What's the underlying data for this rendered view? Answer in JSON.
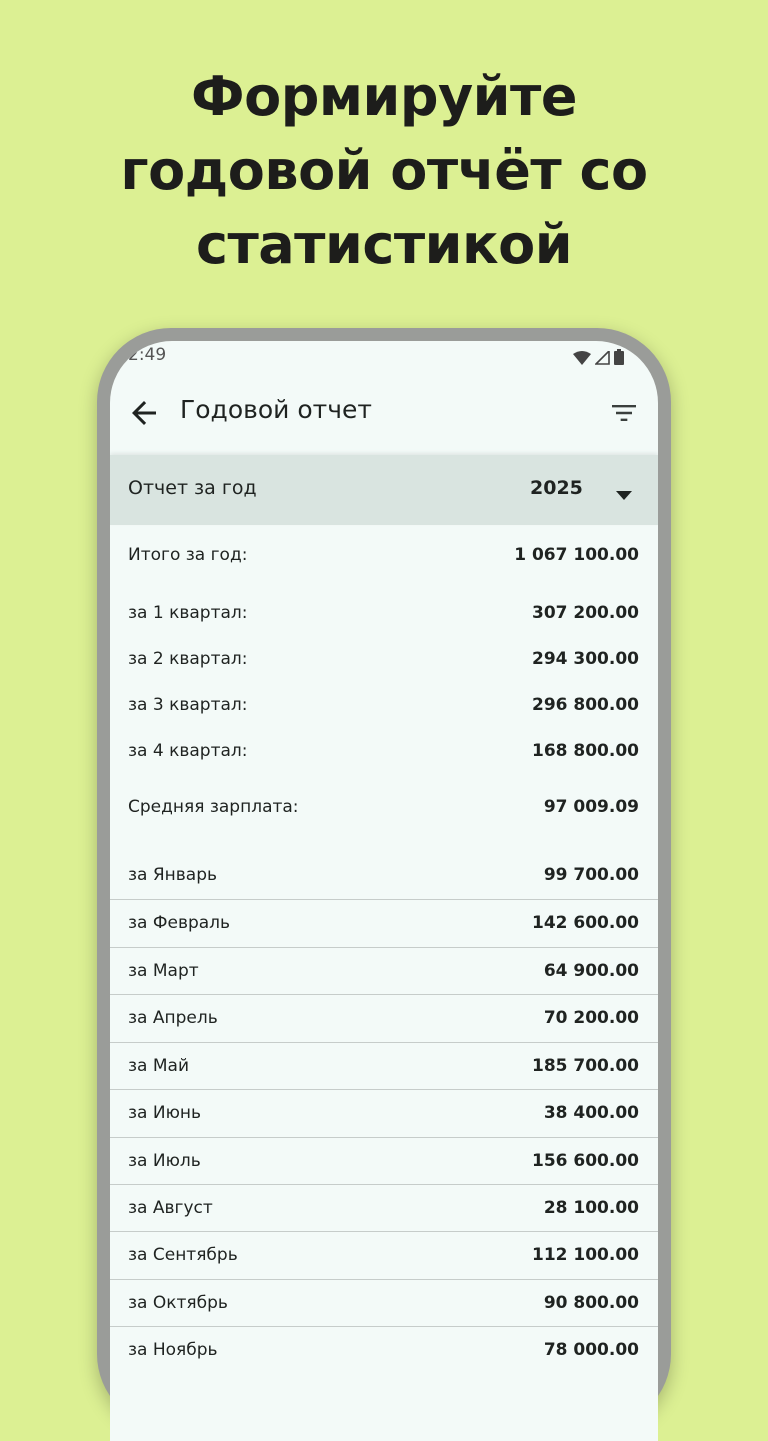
{
  "headline": {
    "line1": "Формируйте",
    "line2": "годовой отчёт со",
    "line3": "статистикой"
  },
  "status_bar": {
    "time": "2:49",
    "icons": [
      "wifi-icon",
      "signal-icon",
      "battery-icon"
    ]
  },
  "app_bar": {
    "title": "Годовой отчет",
    "back_icon": "arrow-back-icon",
    "filter_icon": "filter-icon"
  },
  "year_selector": {
    "label": "Отчет за год",
    "value": "2025"
  },
  "summary": {
    "total_label": "Итого за год:",
    "total_value": "1 067 100.00",
    "quarters": [
      {
        "label": "за 1 квартал:",
        "value": "307 200.00"
      },
      {
        "label": "за 2 квартал:",
        "value": "294 300.00"
      },
      {
        "label": "за 3 квартал:",
        "value": "296 800.00"
      },
      {
        "label": "за 4 квартал:",
        "value": "168 800.00"
      }
    ],
    "average_label": "Средняя зарплата:",
    "average_value": "97 009.09"
  },
  "months": [
    {
      "label": "за Январь",
      "value": "99 700.00"
    },
    {
      "label": "за Февраль",
      "value": "142 600.00"
    },
    {
      "label": "за Март",
      "value": "64 900.00"
    },
    {
      "label": "за Апрель",
      "value": "70 200.00"
    },
    {
      "label": "за Май",
      "value": "185 700.00"
    },
    {
      "label": "за Июнь",
      "value": "38 400.00"
    },
    {
      "label": "за Июль",
      "value": "156 600.00"
    },
    {
      "label": "за Август",
      "value": "28 100.00"
    },
    {
      "label": "за Сентябрь",
      "value": "112 100.00"
    },
    {
      "label": "за Октябрь",
      "value": "90 800.00"
    },
    {
      "label": "за Ноябрь",
      "value": "78 000.00"
    }
  ],
  "colors": {
    "background": "#dcf093",
    "screen": "#f3faf8",
    "year_bar": "#d9e4e0",
    "frame": "#9a9c99"
  }
}
